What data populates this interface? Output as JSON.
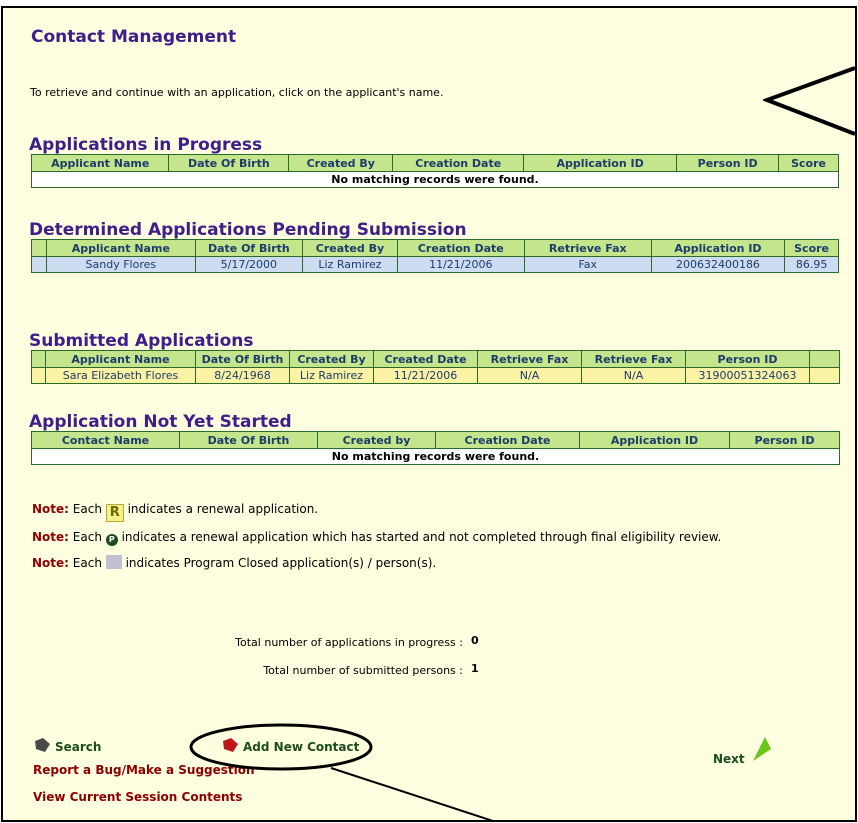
{
  "page_title": "Contact Management",
  "instruction": "To retrieve and continue with an application, click on the applicant's name.",
  "in_progress": {
    "title": "Applications in Progress",
    "columns": [
      "Applicant Name",
      "Date Of Birth",
      "Created By",
      "Creation Date",
      "Application ID",
      "Person ID",
      "Score"
    ],
    "empty_message": "No matching records were found."
  },
  "determined": {
    "title": "Determined Applications Pending Submission",
    "columns": [
      "Applicant Name",
      "Date Of Birth",
      "Created By",
      "Creation Date",
      "Retrieve Fax",
      "Application ID",
      "Score"
    ],
    "rows": [
      [
        "Sandy Flores",
        "5/17/2000",
        "Liz Ramirez",
        "11/21/2006",
        "Fax",
        "200632400186",
        "86.95"
      ]
    ]
  },
  "submitted": {
    "title": "Submitted Applications",
    "columns": [
      "Applicant Name",
      "Date Of Birth",
      "Created By",
      "Created Date",
      "Retrieve Fax",
      "Retrieve Fax",
      "Person ID"
    ],
    "rows": [
      [
        "Sara Elizabeth Flores",
        "8/24/1968",
        "Liz Ramirez",
        "11/21/2006",
        "N/A",
        "N/A",
        "31900051324063"
      ]
    ]
  },
  "not_started": {
    "title": "Application Not Yet Started",
    "columns": [
      "Contact Name",
      "Date Of Birth",
      "Created by",
      "Creation Date",
      "Application ID",
      "Person ID"
    ],
    "empty_message": "No matching records were found."
  },
  "notes": {
    "label": "Note:",
    "renewal": {
      "pre": "Each",
      "icon_letter": "R",
      "post": "indicates a renewal application."
    },
    "started": {
      "pre": "Each",
      "icon_letter": "P",
      "post": "indicates a renewal application which has started and not completed through final eligibility review."
    },
    "closed": {
      "pre": "Each",
      "post": "indicates Program Closed application(s) / person(s)."
    }
  },
  "totals": {
    "in_progress_label": "Total number of applications in progress :",
    "in_progress_value": "0",
    "submitted_label": "Total number of submitted persons :",
    "submitted_value": "1"
  },
  "links": {
    "search": "Search",
    "add_contact": "Add New Contact",
    "next": "Next",
    "report_bug": "Report a Bug/Make a Suggestion",
    "view_session": "View Current Session Contents"
  },
  "colors": {
    "title": "#3e1f8a",
    "header_bg": "#c4e58c",
    "link_red": "#8e0000",
    "link_green": "#1c4d1c",
    "page_bg": "#fefee0"
  }
}
